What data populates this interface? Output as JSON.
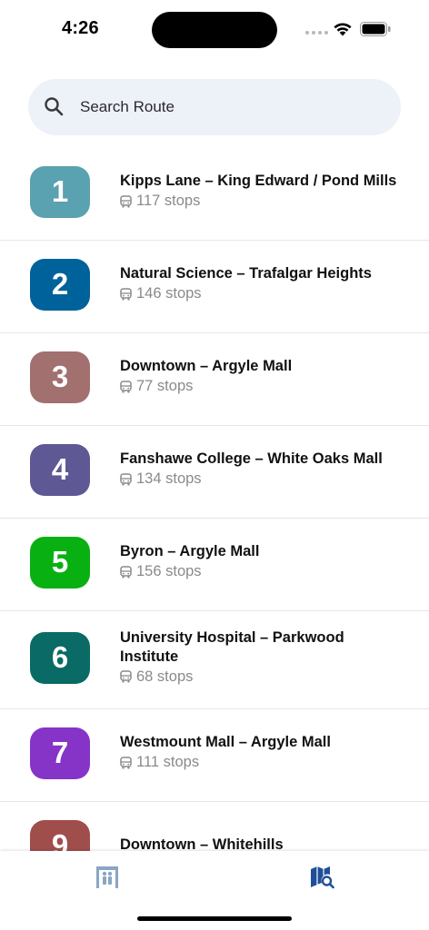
{
  "status": {
    "time": "4:26"
  },
  "search": {
    "placeholder": "Search Route",
    "icon": "search-icon"
  },
  "routes": [
    {
      "number": "1",
      "name": "Kipps Lane – King Edward / Pond Mills",
      "stops": "117 stops",
      "color": "#5aa1b1"
    },
    {
      "number": "2",
      "name": "Natural Science – Trafalgar Heights",
      "stops": "146 stops",
      "color": "#00629a"
    },
    {
      "number": "3",
      "name": "Downtown – Argyle Mall",
      "stops": "77 stops",
      "color": "#a2706f"
    },
    {
      "number": "4",
      "name": "Fanshawe College – White Oaks Mall",
      "stops": "134 stops",
      "color": "#5e5895"
    },
    {
      "number": "5",
      "name": "Byron – Argyle Mall",
      "stops": "156 stops",
      "color": "#09b012"
    },
    {
      "number": "6",
      "name": "University Hospital – Parkwood Institute",
      "stops": "68 stops",
      "color": "#0a6a65"
    },
    {
      "number": "7",
      "name": "Westmount Mall – Argyle Mall",
      "stops": "111 stops",
      "color": "#8634c8"
    },
    {
      "number": "9",
      "name": "Downtown – Whitehills",
      "stops": "",
      "color": "#a04e4c"
    }
  ],
  "tabs": [
    {
      "name": "stops-tab",
      "icon": "bus-stop-icon",
      "active": false,
      "color": "#8aa6c4"
    },
    {
      "name": "routes-tab",
      "icon": "map-search-icon",
      "active": true,
      "color": "#1f4f99"
    }
  ]
}
